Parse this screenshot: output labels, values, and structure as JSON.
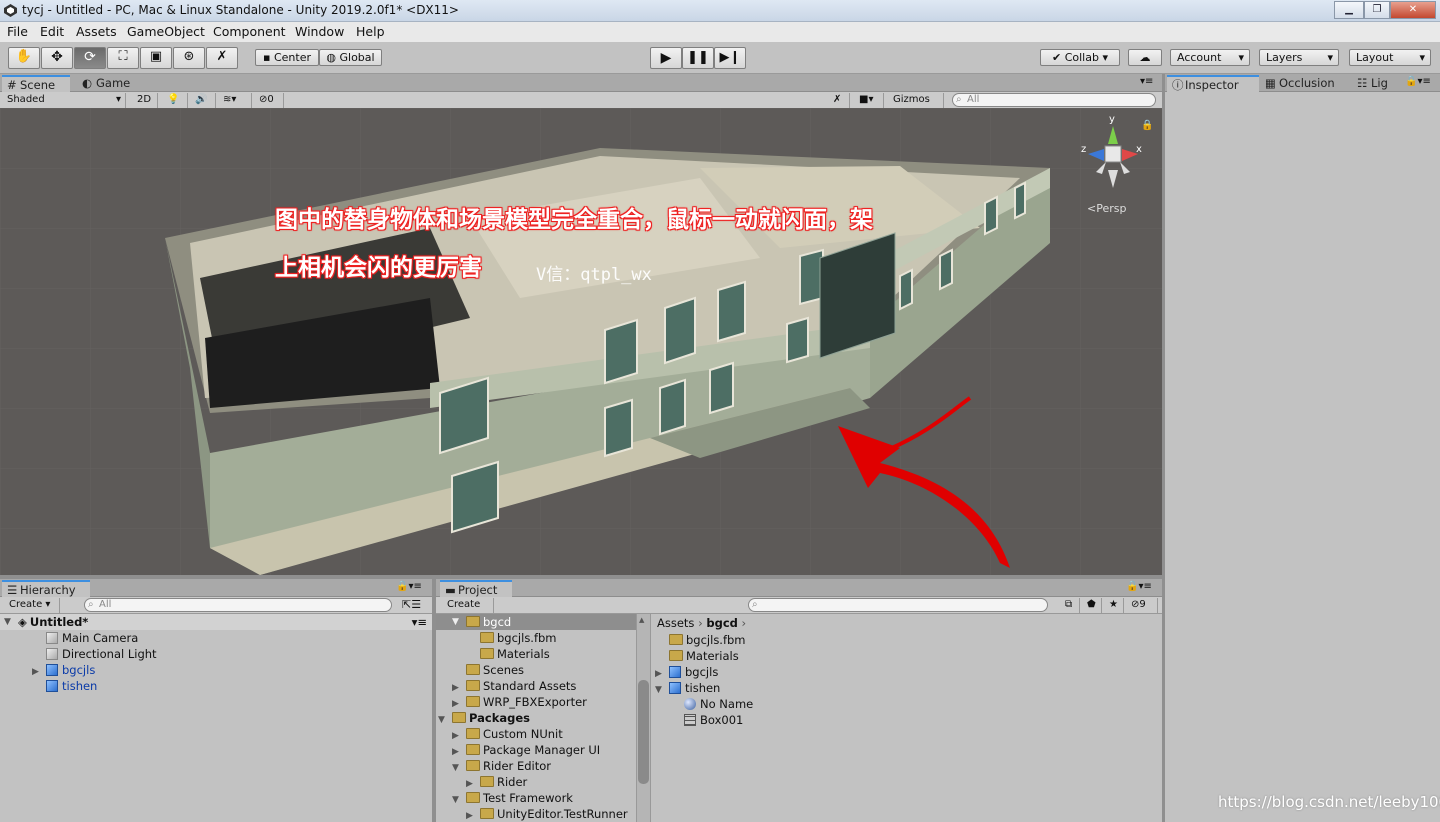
{
  "window": {
    "title": "tycj - Untitled - PC, Mac & Linux Standalone - Unity 2019.2.0f1* <DX11>",
    "minimize": "▁",
    "maximize": "❐",
    "close": "✕"
  },
  "menu": [
    "File",
    "Edit",
    "Assets",
    "GameObject",
    "Component",
    "Window",
    "Help"
  ],
  "toolbar": {
    "tools": [
      "hand-tool-icon",
      "move-tool-icon",
      "rotate-tool-icon",
      "scale-tool-icon",
      "rect-tool-icon",
      "transform-tool-icon",
      "custom-tool-icon"
    ],
    "pivot": "Center",
    "space": "Global",
    "collab": "Collab",
    "account": "Account",
    "layers": "Layers",
    "layout": "Layout"
  },
  "scene": {
    "tab_scene": "Scene",
    "tab_game": "Game",
    "shading": "Shaded",
    "mode2d": "2D",
    "hidden_count": "0",
    "gizmos": "Gizmos",
    "search_placeholder": "All",
    "persp": "<Persp",
    "axis_x": "x",
    "axis_y": "y",
    "axis_z": "z"
  },
  "annotation": {
    "line1": "图中的替身物体和场景模型完全重合，鼠标一动就闪面，架",
    "line2": "上相机会闪的更厉害",
    "watermark": "V信：qtpl_wx"
  },
  "inspector": {
    "tab_inspector": "Inspector",
    "tab_occlusion": "Occlusion",
    "tab_lighting": "Lig"
  },
  "hierarchy": {
    "tab": "Hierarchy",
    "create": "Create",
    "search_placeholder": "All",
    "scene_name": "Untitled*",
    "items": [
      {
        "label": "Main Camera",
        "prefab": false
      },
      {
        "label": "Directional Light",
        "prefab": false
      },
      {
        "label": "bgcjls",
        "prefab": true
      },
      {
        "label": "tishen",
        "prefab": true
      }
    ]
  },
  "project": {
    "tab": "Project",
    "create": "Create",
    "hidden_count": "9",
    "tree": [
      "bgcd",
      "bgcjls.fbm",
      "Materials",
      "Scenes",
      "Standard Assets",
      "WRP_FBXExporter",
      "Packages",
      "Custom NUnit",
      "Package Manager UI",
      "Rider Editor",
      "Rider",
      "Test Framework",
      "UnityEditor.TestRunner"
    ],
    "breadcrumb_root": "Assets",
    "breadcrumb_current": "bgcd",
    "contents": [
      "bgcjls.fbm",
      "Materials",
      "bgcjls",
      "tishen",
      "No Name",
      "Box001"
    ]
  },
  "footer_watermark": "https://blog.csdn.net/leeby100",
  "colors": {
    "annotation_outline": "#e22222",
    "arrow": "#e00000",
    "scene_bg": "#5d5a58",
    "accent_tab": "#3d8fe0"
  }
}
